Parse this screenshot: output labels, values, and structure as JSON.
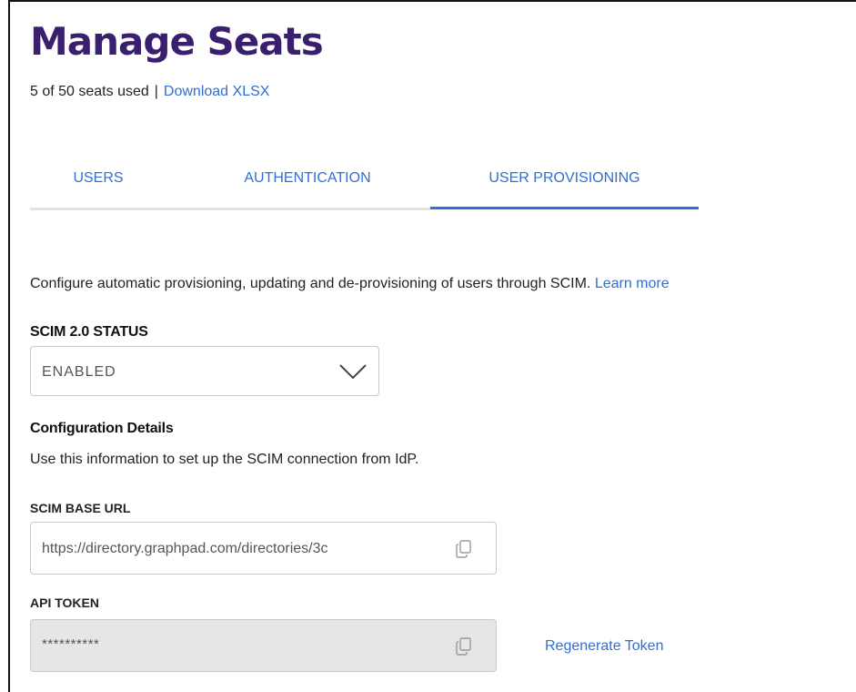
{
  "header": {
    "title": "Manage Seats",
    "seats_used": "5 of 50 seats used",
    "separator": "|",
    "download_link": "Download XLSX"
  },
  "tabs": [
    {
      "label": "USERS",
      "active": false
    },
    {
      "label": "AUTHENTICATION",
      "active": false
    },
    {
      "label": "USER PROVISIONING",
      "active": true
    }
  ],
  "provisioning": {
    "intro_text": "Configure automatic provisioning, updating and de-provisioning of users through SCIM.",
    "learn_more": "Learn more",
    "status_label": "SCIM 2.0 STATUS",
    "status_value": "ENABLED",
    "config_heading": "Configuration Details",
    "config_desc": "Use this information to set up the SCIM connection from IdP.",
    "base_url_label": "SCIM BASE URL",
    "base_url_value": "https://directory.graphpad.com/directories/3c",
    "api_token_label": "API TOKEN",
    "api_token_value": "**********",
    "regenerate_label": "Regenerate Token"
  },
  "icons": {
    "chevron": "chevron-down-icon",
    "copy": "copy-icon"
  },
  "colors": {
    "title": "#3a1f6e",
    "link": "#2f6fd6",
    "tab_indicator": "#2f6fd6",
    "disabled_field": "#e6e6e6"
  }
}
